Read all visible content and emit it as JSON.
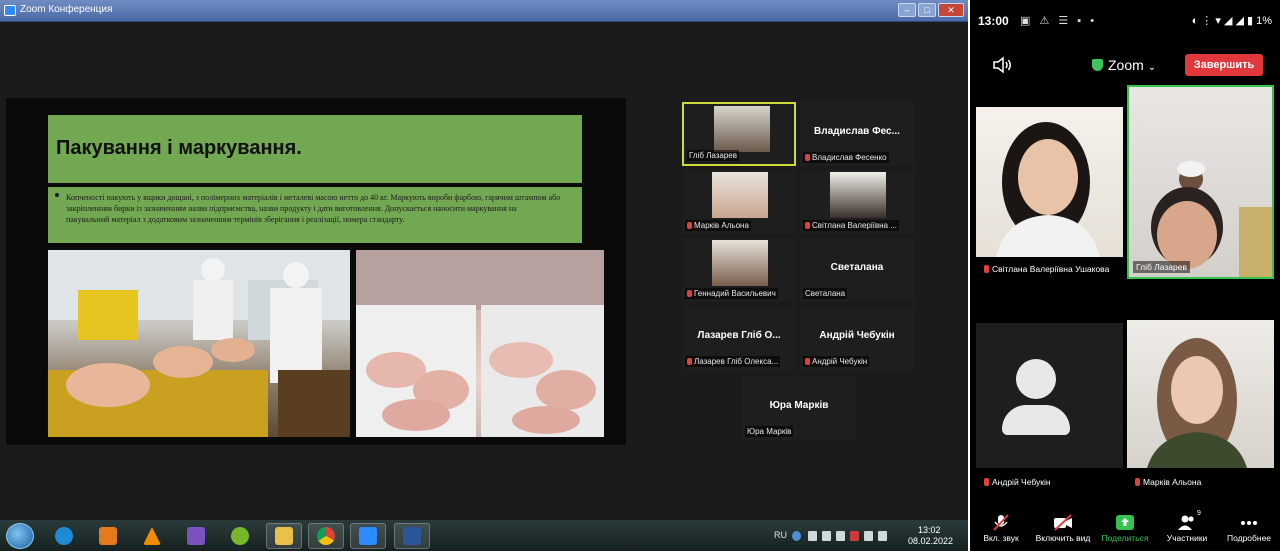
{
  "window": {
    "title": "Zoom Конференция"
  },
  "slide": {
    "title": "Пакування і маркування.",
    "body": "Копченості пакують у ящики дощані, з полімерних матеріалів і металеві масою нетто до 40 кг. Маркують вироби фарбою, гарячим штампом або закріпленням бирки із зазначенням назви підприємства, назви продукту і дати виготовлення. Допускається наносити маркування на пакувальний матеріал з додатковим зазначенням термінів зберігання і реалізації, номера стандарту."
  },
  "gallery": [
    {
      "name": "",
      "label": "Гліб Лазарев",
      "video": true,
      "active": true
    },
    {
      "name": "Владислав Фес...",
      "label": "Владислав Фесенко",
      "video": false
    },
    {
      "name": "",
      "label": "Марків Альона",
      "video": true
    },
    {
      "name": "",
      "label": "Світлана Валеріївна ...",
      "video": true
    },
    {
      "name": "",
      "label": "Геннадий Васильевич",
      "video": true
    },
    {
      "name": "Светалана",
      "label": "Светалана",
      "video": false
    },
    {
      "name": "Лазарев Гліб О...",
      "label": "Лазарев Гліб Олекса...",
      "video": false
    },
    {
      "name": "Андрій Чебукін",
      "label": "Андрій Чебукін",
      "video": false
    },
    {
      "name": "Юра Марків",
      "label": "Юра Марків",
      "video": false
    }
  ],
  "taskbar": {
    "apps": [
      "start",
      "ie",
      "media-player",
      "vlc",
      "visual-studio",
      "utorrent",
      "file-explorer",
      "chrome",
      "zoom",
      "word"
    ],
    "lang": "RU",
    "time": "13:02",
    "date": "08.02.2022"
  },
  "phone": {
    "status_time": "13:00",
    "status_right": "1%",
    "zoom_label": "Zoom",
    "end_button": "Завершить",
    "participants": [
      {
        "name": "Світлана Валеріївна Ушакова"
      },
      {
        "name": "Гліб Лазарев"
      },
      {
        "name": "Андрій Чебукін"
      },
      {
        "name": "Марків Альона"
      }
    ],
    "toolbar": [
      {
        "icon": "mic-off-icon",
        "label": "Вкл. звук"
      },
      {
        "icon": "camera-off-icon",
        "label": "Включить вид"
      },
      {
        "icon": "share-icon",
        "label": "Поделиться"
      },
      {
        "icon": "participants-icon",
        "label": "Участники",
        "badge": "9"
      },
      {
        "icon": "more-icon",
        "label": "Подробнее"
      }
    ]
  },
  "colors": {
    "slide_green": "#72a852",
    "end_red": "#e0383b",
    "speaking_green": "#36c24f",
    "share_green": "#36c24f",
    "mic_red": "#e04040"
  }
}
